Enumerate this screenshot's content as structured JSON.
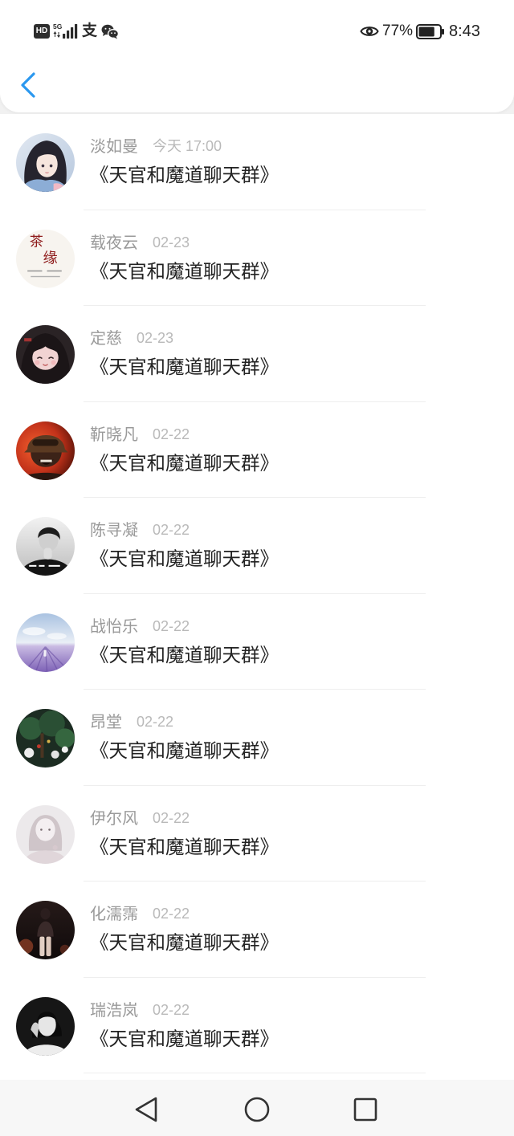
{
  "status_bar": {
    "hd_badge": "HD",
    "network_type": "5G",
    "alipay_glyph": "支",
    "battery_percent": "77%",
    "battery_level": 0.77,
    "time": "8:43",
    "icons": [
      "hd-icon",
      "signal-icon",
      "alipay-icon",
      "wechat-icon",
      "eye-icon",
      "battery-icon"
    ]
  },
  "header": {
    "back_icon": "chevron-left-icon"
  },
  "colors": {
    "accent": "#2b98ef",
    "sender": "#9a9a9a",
    "time": "#b9b9b9",
    "message": "#222222",
    "navbar": "#f7f7f7"
  },
  "messages": [
    {
      "sender": "淡如曼",
      "time": "今天 17:00",
      "text": "《天官和魔道聊天群》"
    },
    {
      "sender": "载夜云",
      "time": "02-23",
      "text": "《天官和魔道聊天群》",
      "avatar_text": [
        "茶",
        "缘"
      ]
    },
    {
      "sender": "定慈",
      "time": "02-23",
      "text": "《天官和魔道聊天群》"
    },
    {
      "sender": "靳晓凡",
      "time": "02-22",
      "text": "《天官和魔道聊天群》"
    },
    {
      "sender": "陈寻凝",
      "time": "02-22",
      "text": "《天官和魔道聊天群》"
    },
    {
      "sender": "战怡乐",
      "time": "02-22",
      "text": "《天官和魔道聊天群》"
    },
    {
      "sender": "昂堂",
      "time": "02-22",
      "text": "《天官和魔道聊天群》"
    },
    {
      "sender": "伊尔风",
      "time": "02-22",
      "text": "《天官和魔道聊天群》"
    },
    {
      "sender": "化濡霈",
      "time": "02-22",
      "text": "《天官和魔道聊天群》"
    },
    {
      "sender": "瑞浩岚",
      "time": "02-22",
      "text": "《天官和魔道聊天群》"
    }
  ],
  "nav_bar": {
    "icons": [
      "back-triangle-icon",
      "home-circle-icon",
      "recents-square-icon"
    ]
  }
}
